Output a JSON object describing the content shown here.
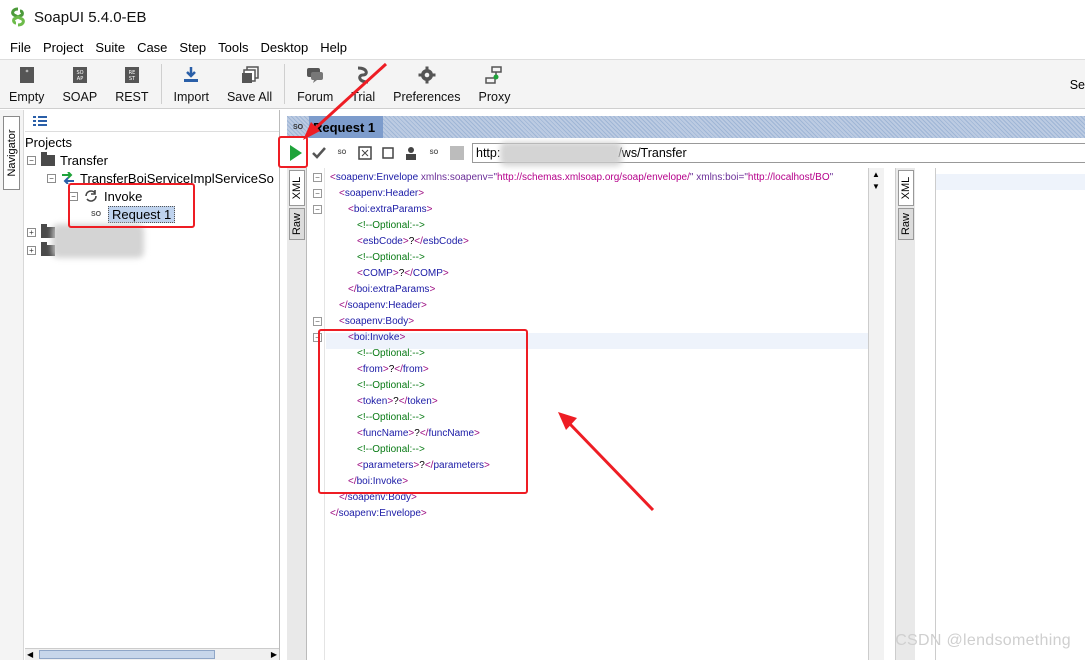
{
  "window": {
    "title": "SoapUI 5.4.0-EB"
  },
  "menu": [
    {
      "label": "File",
      "mnemonic": "F"
    },
    {
      "label": "Project",
      "mnemonic": ""
    },
    {
      "label": "Suite",
      "mnemonic": ""
    },
    {
      "label": "Case",
      "mnemonic": ""
    },
    {
      "label": "Step",
      "mnemonic": ""
    },
    {
      "label": "Tools",
      "mnemonic": "T"
    },
    {
      "label": "Desktop",
      "mnemonic": "D"
    },
    {
      "label": "Help",
      "mnemonic": "H"
    }
  ],
  "toolbar": {
    "items": [
      {
        "label": "Empty",
        "icon": "empty-project-icon"
      },
      {
        "label": "SOAP",
        "icon": "soap-project-icon"
      },
      {
        "label": "REST",
        "icon": "rest-project-icon"
      },
      {
        "label": "Import",
        "icon": "import-icon"
      },
      {
        "label": "Save All",
        "icon": "save-all-icon"
      },
      {
        "label": "Forum",
        "icon": "forum-icon"
      },
      {
        "label": "Trial",
        "icon": "trial-icon"
      },
      {
        "label": "Preferences",
        "icon": "gear-icon"
      },
      {
        "label": "Proxy",
        "icon": "proxy-icon"
      }
    ],
    "right_label": "Se"
  },
  "navigator": {
    "tab_label": "Navigator"
  },
  "tree": {
    "root_label": "Projects",
    "project": "Transfer",
    "interface": "TransferBoiServiceImplServiceSo",
    "operation": "Invoke",
    "request": "Request 1",
    "request_icon_text": "SO"
  },
  "editor": {
    "title": "Request 1",
    "endpoint_prefix": "http:",
    "endpoint_suffix": "/ws/Transfer",
    "tabs": {
      "left": [
        "XML",
        "Raw"
      ],
      "right": [
        "XML",
        "Raw"
      ]
    },
    "xml_lines": [
      {
        "indent": 0,
        "kind": "open-attrs",
        "tag": "soapenv:Envelope",
        "attrs": [
          {
            "name": "xmlns:soapenv",
            "value": "http://schemas.xmlsoap.org/soap/envelope/"
          },
          {
            "name": "xmlns:boi",
            "value": "http://localhost/BO"
          }
        ]
      },
      {
        "indent": 1,
        "kind": "open",
        "tag": "soapenv:Header"
      },
      {
        "indent": 2,
        "kind": "open",
        "tag": "boi:extraParams"
      },
      {
        "indent": 3,
        "kind": "comment",
        "text": "<!--Optional:-->"
      },
      {
        "indent": 3,
        "kind": "leaf",
        "tag": "esbCode",
        "value": "?"
      },
      {
        "indent": 3,
        "kind": "comment",
        "text": "<!--Optional:-->"
      },
      {
        "indent": 3,
        "kind": "leaf",
        "tag": "COMP",
        "value": "?"
      },
      {
        "indent": 2,
        "kind": "close",
        "tag": "boi:extraParams"
      },
      {
        "indent": 1,
        "kind": "close",
        "tag": "soapenv:Header"
      },
      {
        "indent": 1,
        "kind": "open",
        "tag": "soapenv:Body"
      },
      {
        "indent": 2,
        "kind": "open",
        "tag": "boi:Invoke"
      },
      {
        "indent": 3,
        "kind": "comment",
        "text": "<!--Optional:-->"
      },
      {
        "indent": 3,
        "kind": "leaf",
        "tag": "from",
        "value": "?"
      },
      {
        "indent": 3,
        "kind": "comment",
        "text": "<!--Optional:-->"
      },
      {
        "indent": 3,
        "kind": "leaf",
        "tag": "token",
        "value": "?"
      },
      {
        "indent": 3,
        "kind": "comment",
        "text": "<!--Optional:-->"
      },
      {
        "indent": 3,
        "kind": "leaf",
        "tag": "funcName",
        "value": "?"
      },
      {
        "indent": 3,
        "kind": "comment",
        "text": "<!--Optional:-->"
      },
      {
        "indent": 3,
        "kind": "leaf",
        "tag": "parameters",
        "value": "?"
      },
      {
        "indent": 2,
        "kind": "close",
        "tag": "boi:Invoke"
      },
      {
        "indent": 1,
        "kind": "close",
        "tag": "soapenv:Body"
      },
      {
        "indent": 0,
        "kind": "close",
        "tag": "soapenv:Envelope"
      }
    ]
  },
  "colors": {
    "annotation_red": "#ee1d24",
    "run_green": "#1fa33a",
    "title_band": "#7d9ccc",
    "xml_comment": "#087a14",
    "xml_tag": "#1a1aa6",
    "xml_bracket": "#9b0b80"
  },
  "watermark": "CSDN @lendsomething"
}
